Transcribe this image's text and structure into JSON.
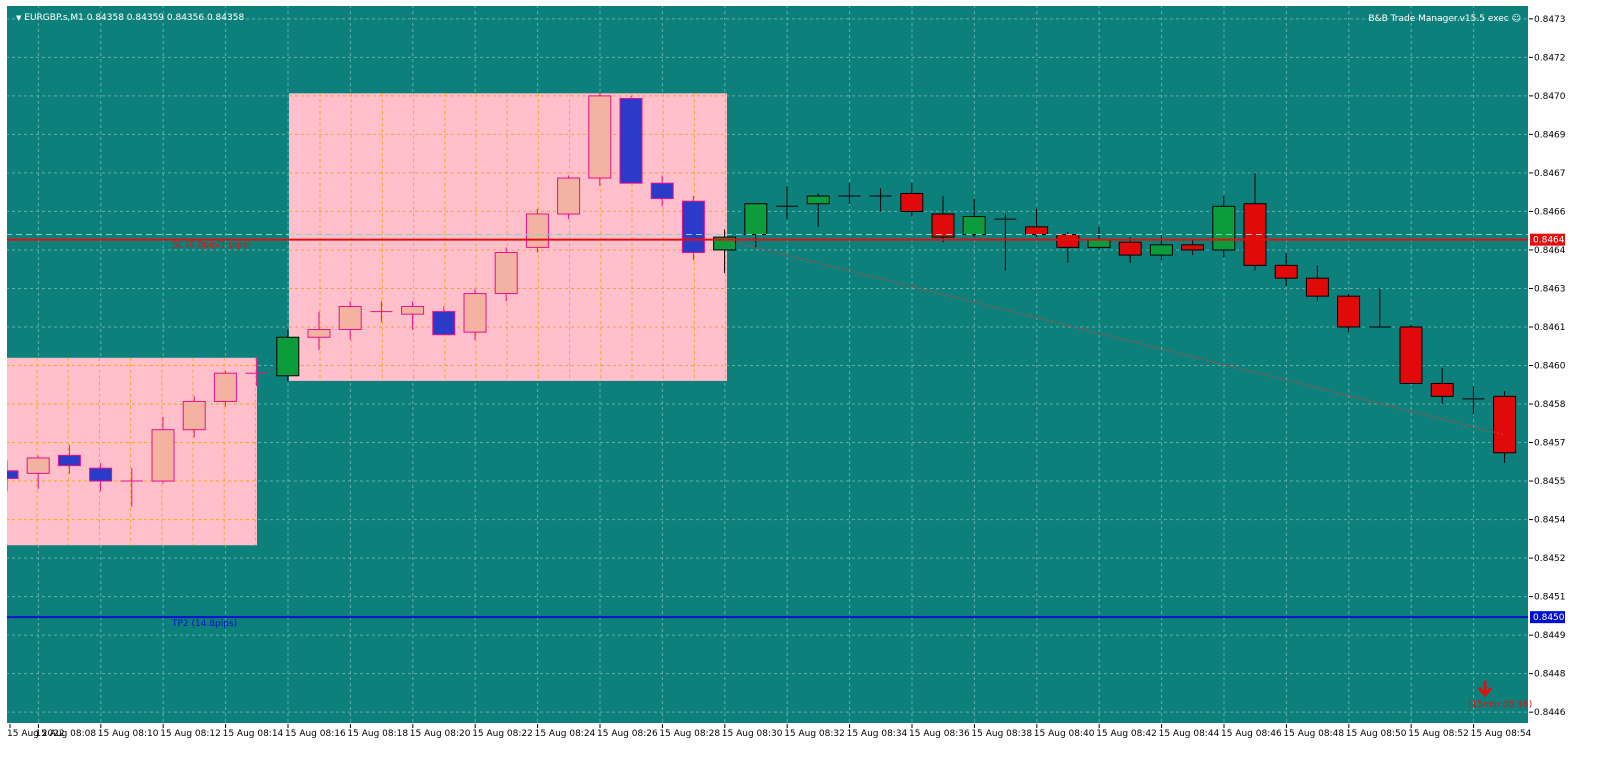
{
  "window": {
    "symbol_info": "EURGBP.s,M1  0.84358 0.84359 0.84356 0.84358",
    "indicator_name": "B&B Trade Manager.v15.5 exec",
    "dropdown_icon": "triangle-down-icon",
    "status_icon": "smiley-icon"
  },
  "colors": {
    "background": "#0e807b",
    "grid": "#5fb0a8",
    "bull_candle": "#0d9c3c",
    "bear_candle": "#e00a0a",
    "zone_fill": "#ffc0cb",
    "zone_candle_up": "#f4b3a0",
    "zone_candle_down": "#2c3ac8",
    "zone_candle_border": "#e8108c",
    "zone_grid": "#f5a623",
    "sl_line": "#e01010",
    "tp_line": "#0010d0",
    "trend_line": "#d33b3b",
    "axis_text": "#000000"
  },
  "lines": {
    "sl": {
      "price": 0.84649,
      "label": "SL (0.0pip/1 pips)",
      "price_tag": "0.84649"
    },
    "tp": {
      "price": 0.84502,
      "label": "TP2 (14.8pips)",
      "price_tag": "0.84502"
    },
    "ask_dashed": {
      "price": 0.84651
    },
    "trend": {
      "from": {
        "time": "15 Aug 08:29",
        "price": 0.84649
      },
      "to": {
        "time": "15 Aug 08:54",
        "price": 0.84573
      }
    }
  },
  "zones": [
    {
      "from": "15 Aug 08:01",
      "to": "15 Aug 08:14",
      "high": 0.84603,
      "low": 0.8453
    },
    {
      "from": "15 Aug 08:15",
      "to": "15 Aug 08:28",
      "high": 0.84706,
      "low": 0.84594
    }
  ],
  "chart_data": {
    "type": "candlestick",
    "symbol": "EURGBP.s",
    "timeframe": "M1",
    "ylim": [
      0.8446,
      0.8474
    ],
    "y_ticks": [
      "0.84735",
      "0.84720",
      "0.84705",
      "0.84690",
      "0.84675",
      "0.84660",
      "0.84645",
      "0.84630",
      "0.84615",
      "0.84600",
      "0.84585",
      "0.84570",
      "0.84555",
      "0.84540",
      "0.84525",
      "0.84510",
      "0.84495",
      "0.84480",
      "0.84465"
    ],
    "x_ticks": [
      "15 Aug 2022",
      "15 Aug 08:08",
      "15 Aug 08:10",
      "15 Aug 08:12",
      "15 Aug 08:14",
      "15 Aug 08:16",
      "15 Aug 08:18",
      "15 Aug 08:20",
      "15 Aug 08:22",
      "15 Aug 08:24",
      "15 Aug 08:26",
      "15 Aug 08:28",
      "15 Aug 08:30",
      "15 Aug 08:32",
      "15 Aug 08:34",
      "15 Aug 08:36",
      "15 Aug 08:38",
      "15 Aug 08:40",
      "15 Aug 08:42",
      "15 Aug 08:44",
      "15 Aug 08:46",
      "15 Aug 08:48",
      "15 Aug 08:50",
      "15 Aug 08:52",
      "15 Aug 08:54"
    ],
    "candles": [
      {
        "t": "08:06",
        "o": 0.84559,
        "h": 0.84563,
        "l": 0.84551,
        "c": 0.84556
      },
      {
        "t": "08:07",
        "o": 0.84558,
        "h": 0.84565,
        "l": 0.84552,
        "c": 0.84564
      },
      {
        "t": "08:08",
        "o": 0.84565,
        "h": 0.84569,
        "l": 0.84558,
        "c": 0.84561
      },
      {
        "t": "08:09",
        "o": 0.8456,
        "h": 0.84562,
        "l": 0.84551,
        "c": 0.84555
      },
      {
        "t": "08:10",
        "o": 0.84555,
        "h": 0.8456,
        "l": 0.84545,
        "c": 0.84555
      },
      {
        "t": "08:11",
        "o": 0.84555,
        "h": 0.8458,
        "l": 0.84554,
        "c": 0.84575
      },
      {
        "t": "08:12",
        "o": 0.84575,
        "h": 0.84588,
        "l": 0.84572,
        "c": 0.84586
      },
      {
        "t": "08:13",
        "o": 0.84586,
        "h": 0.84598,
        "l": 0.84584,
        "c": 0.84597
      },
      {
        "t": "08:14",
        "o": 0.84597,
        "h": 0.84603,
        "l": 0.84592,
        "c": 0.84597
      },
      {
        "t": "08:15",
        "o": 0.84596,
        "h": 0.84614,
        "l": 0.84594,
        "c": 0.84611
      },
      {
        "t": "08:16",
        "o": 0.84611,
        "h": 0.84621,
        "l": 0.84606,
        "c": 0.84614
      },
      {
        "t": "08:17",
        "o": 0.84614,
        "h": 0.84625,
        "l": 0.8461,
        "c": 0.84623
      },
      {
        "t": "08:18",
        "o": 0.84621,
        "h": 0.84625,
        "l": 0.84617,
        "c": 0.84621
      },
      {
        "t": "08:19",
        "o": 0.8462,
        "h": 0.84625,
        "l": 0.84614,
        "c": 0.84623
      },
      {
        "t": "08:20",
        "o": 0.84621,
        "h": 0.84623,
        "l": 0.84612,
        "c": 0.84612
      },
      {
        "t": "08:21",
        "o": 0.84613,
        "h": 0.8463,
        "l": 0.8461,
        "c": 0.84628
      },
      {
        "t": "08:22",
        "o": 0.84628,
        "h": 0.84646,
        "l": 0.84625,
        "c": 0.84644
      },
      {
        "t": "08:23",
        "o": 0.84646,
        "h": 0.84661,
        "l": 0.84644,
        "c": 0.84659
      },
      {
        "t": "08:24",
        "o": 0.84659,
        "h": 0.84674,
        "l": 0.84657,
        "c": 0.84673
      },
      {
        "t": "08:25",
        "o": 0.84673,
        "h": 0.84706,
        "l": 0.8467,
        "c": 0.84705
      },
      {
        "t": "08:26",
        "o": 0.84704,
        "h": 0.84705,
        "l": 0.84671,
        "c": 0.84671
      },
      {
        "t": "08:27",
        "o": 0.84671,
        "h": 0.84674,
        "l": 0.84662,
        "c": 0.84665
      },
      {
        "t": "08:28",
        "o": 0.84664,
        "h": 0.84666,
        "l": 0.84641,
        "c": 0.84644
      },
      {
        "t": "08:29",
        "o": 0.84645,
        "h": 0.84653,
        "l": 0.84636,
        "c": 0.8465
      },
      {
        "t": "08:30",
        "o": 0.84651,
        "h": 0.84663,
        "l": 0.84646,
        "c": 0.84663
      },
      {
        "t": "08:31",
        "o": 0.84662,
        "h": 0.8467,
        "l": 0.84657,
        "c": 0.84662
      },
      {
        "t": "08:32",
        "o": 0.84663,
        "h": 0.84667,
        "l": 0.84654,
        "c": 0.84666
      },
      {
        "t": "08:33",
        "o": 0.84666,
        "h": 0.84671,
        "l": 0.84663,
        "c": 0.84666
      },
      {
        "t": "08:34",
        "o": 0.84666,
        "h": 0.84669,
        "l": 0.8466,
        "c": 0.84667
      },
      {
        "t": "08:35",
        "o": 0.84667,
        "h": 0.84671,
        "l": 0.84658,
        "c": 0.8466
      },
      {
        "t": "08:36",
        "o": 0.84659,
        "h": 0.84666,
        "l": 0.84648,
        "c": 0.8465
      },
      {
        "t": "08:37",
        "o": 0.84651,
        "h": 0.84665,
        "l": 0.8465,
        "c": 0.84658
      },
      {
        "t": "08:38",
        "o": 0.84657,
        "h": 0.84659,
        "l": 0.84637,
        "c": 0.84656
      },
      {
        "t": "08:39",
        "o": 0.84654,
        "h": 0.84661,
        "l": 0.8465,
        "c": 0.84651
      },
      {
        "t": "08:40",
        "o": 0.84651,
        "h": 0.84652,
        "l": 0.8464,
        "c": 0.84646
      },
      {
        "t": "08:41",
        "o": 0.84646,
        "h": 0.84654,
        "l": 0.84645,
        "c": 0.84649
      },
      {
        "t": "08:42",
        "o": 0.84648,
        "h": 0.8465,
        "l": 0.8464,
        "c": 0.84643
      },
      {
        "t": "08:43",
        "o": 0.84643,
        "h": 0.84651,
        "l": 0.84641,
        "c": 0.84647
      },
      {
        "t": "08:44",
        "o": 0.84647,
        "h": 0.84649,
        "l": 0.84643,
        "c": 0.84645
      },
      {
        "t": "08:45",
        "o": 0.84645,
        "h": 0.84666,
        "l": 0.84642,
        "c": 0.84662
      },
      {
        "t": "08:46",
        "o": 0.84663,
        "h": 0.84675,
        "l": 0.84637,
        "c": 0.84639
      },
      {
        "t": "08:47",
        "o": 0.84639,
        "h": 0.84644,
        "l": 0.84631,
        "c": 0.84634
      },
      {
        "t": "08:48",
        "o": 0.84634,
        "h": 0.84639,
        "l": 0.84625,
        "c": 0.84627
      },
      {
        "t": "08:49",
        "o": 0.84627,
        "h": 0.84628,
        "l": 0.84613,
        "c": 0.84615
      },
      {
        "t": "08:50",
        "o": 0.84615,
        "h": 0.8463,
        "l": 0.84615,
        "c": 0.84615
      },
      {
        "t": "08:51",
        "o": 0.84615,
        "h": 0.84616,
        "l": 0.84593,
        "c": 0.84593
      },
      {
        "t": "08:52",
        "o": 0.84593,
        "h": 0.84599,
        "l": 0.84585,
        "c": 0.84588
      },
      {
        "t": "08:53",
        "o": 0.84587,
        "h": 0.84592,
        "l": 0.84581,
        "c": 0.84588
      },
      {
        "t": "08:54",
        "o": 0.84588,
        "h": 0.8459,
        "l": 0.84562,
        "c": 0.84566
      }
    ]
  },
  "signal": {
    "icon": "arrow-down-icon",
    "label": "(15min 08:16)"
  }
}
